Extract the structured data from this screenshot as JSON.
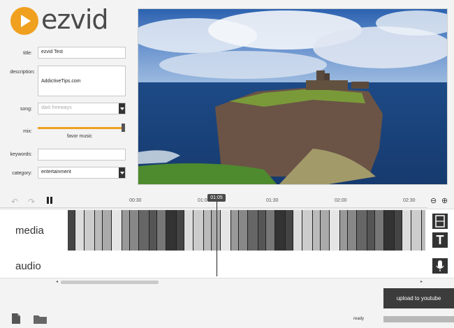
{
  "app": {
    "logo_text": "ezvid"
  },
  "form": {
    "title_label": "title:",
    "title_value": "ezvid Test",
    "description_label": "description:",
    "description_value": "AddictiveTips.com",
    "song_label": "song:",
    "song_value": "dark freeways",
    "mix_label": "mix:",
    "mix_caption": "favor music",
    "mix_level": 0.98,
    "keywords_label": "keywords:",
    "keywords_value": "",
    "category_label": "category:",
    "category_value": "entertainment"
  },
  "timeline": {
    "ticks": [
      "00:30",
      "01:00",
      "01:30",
      "02:00",
      "02:30"
    ],
    "playhead_time": "01:05",
    "media_label": "media",
    "audio_label": "audio"
  },
  "footer": {
    "upload_label": "upload to youtube",
    "status": "ready"
  },
  "colors": {
    "accent": "#f0a01f",
    "dark": "#3c3c3c"
  }
}
